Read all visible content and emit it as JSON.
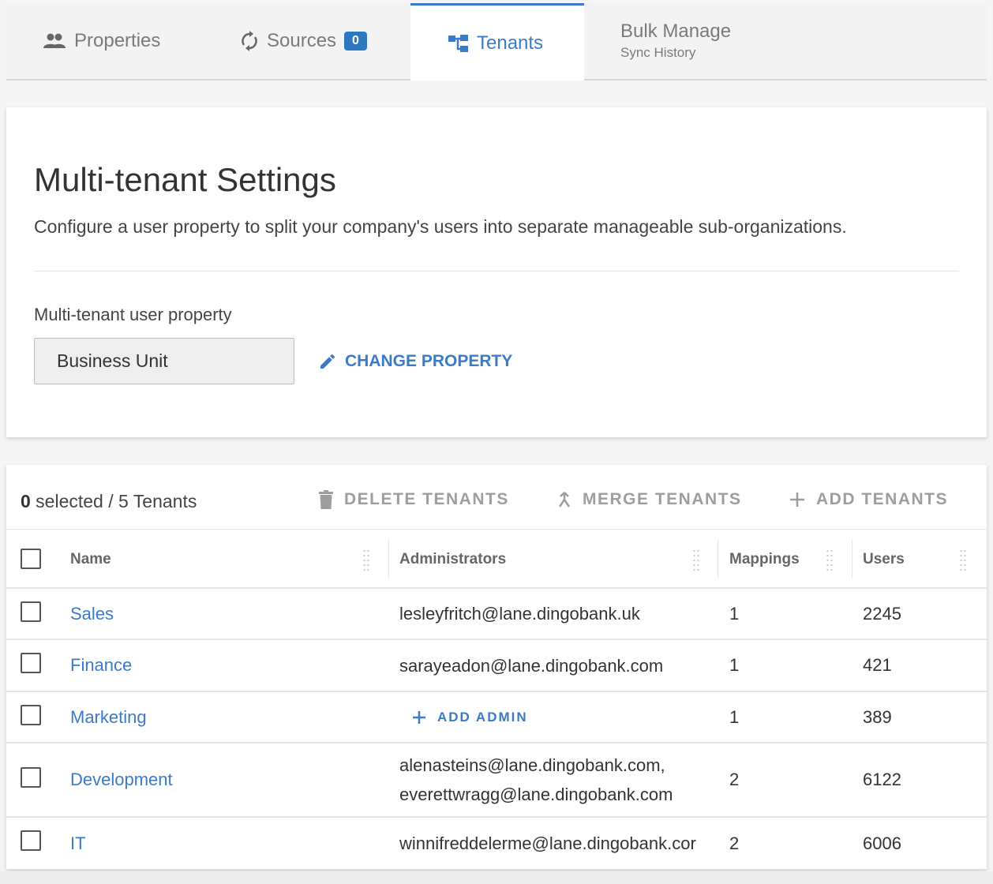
{
  "tabs": {
    "properties": {
      "label": "Properties",
      "icon": "people-icon"
    },
    "sources": {
      "label": "Sources",
      "icon": "sync-icon",
      "badge": "0"
    },
    "tenants": {
      "label": "Tenants",
      "icon": "hierarchy-icon",
      "active": true
    },
    "bulk": {
      "label": "Bulk Manage",
      "sublabel": "Sync History"
    }
  },
  "settings": {
    "title": "Multi-tenant Settings",
    "description": "Configure a user property to split your company's users into separate manageable sub-organizations.",
    "property_label": "Multi-tenant user property",
    "property_value": "Business Unit",
    "change_button": "CHANGE PROPERTY"
  },
  "tenants": {
    "selected_count": "0",
    "selected_suffix": " selected / 5 Tenants",
    "toolbar": {
      "delete": "DELETE TENANTS",
      "merge": "MERGE TENANTS",
      "add": "ADD TENANTS"
    },
    "columns": {
      "name": "Name",
      "administrators": "Administrators",
      "mappings": "Mappings",
      "users": "Users"
    },
    "add_admin_label": "ADD ADMIN",
    "rows": [
      {
        "name": "Sales",
        "admins": [
          "lesleyfritch@lane.dingobank.uk"
        ],
        "mappings": "1",
        "users": "2245"
      },
      {
        "name": "Finance",
        "admins": [
          "sarayeadon@lane.dingobank.com"
        ],
        "mappings": "1",
        "users": "421"
      },
      {
        "name": "Marketing",
        "admins": [],
        "mappings": "1",
        "users": "389"
      },
      {
        "name": "Development",
        "admins": [
          "alenasteins@lane.dingobank.com,",
          "everettwragg@lane.dingobank.com"
        ],
        "mappings": "2",
        "users": "6122"
      },
      {
        "name": "IT",
        "admins": [
          "winnifreddelerme@lane.dingobank.cor"
        ],
        "mappings": "2",
        "users": "6006"
      }
    ]
  },
  "colors": {
    "accent": "#3a7bc8",
    "badge": "#2e78c2",
    "disabled": "#9e9e9e"
  }
}
